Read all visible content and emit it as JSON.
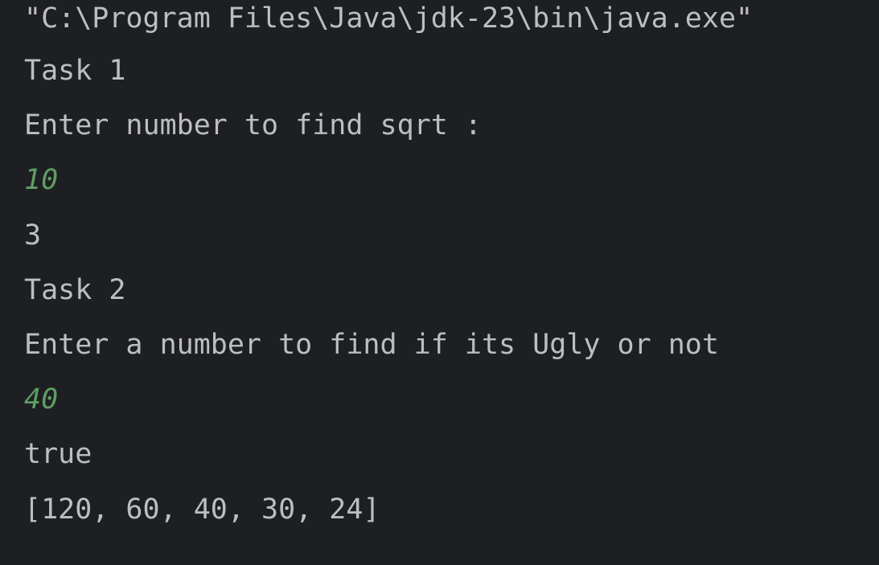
{
  "console": {
    "colors": {
      "background": "#1e1f22",
      "output_text": "#bcbec4",
      "user_input_text": "#5d9e63"
    },
    "lines": [
      {
        "text": "\"C:\\Program Files\\Java\\jdk-23\\bin\\java.exe\"",
        "kind": "command"
      },
      {
        "text": "Task 1",
        "kind": "output"
      },
      {
        "text": "Enter number to find sqrt :",
        "kind": "output"
      },
      {
        "text": "10",
        "kind": "user-input"
      },
      {
        "text": "3",
        "kind": "output"
      },
      {
        "text": "Task 2",
        "kind": "output"
      },
      {
        "text": "Enter a number to find if its Ugly or not",
        "kind": "output"
      },
      {
        "text": "40",
        "kind": "user-input"
      },
      {
        "text": "true",
        "kind": "output"
      },
      {
        "text": "[120, 60, 40, 30, 24]",
        "kind": "output"
      }
    ]
  }
}
